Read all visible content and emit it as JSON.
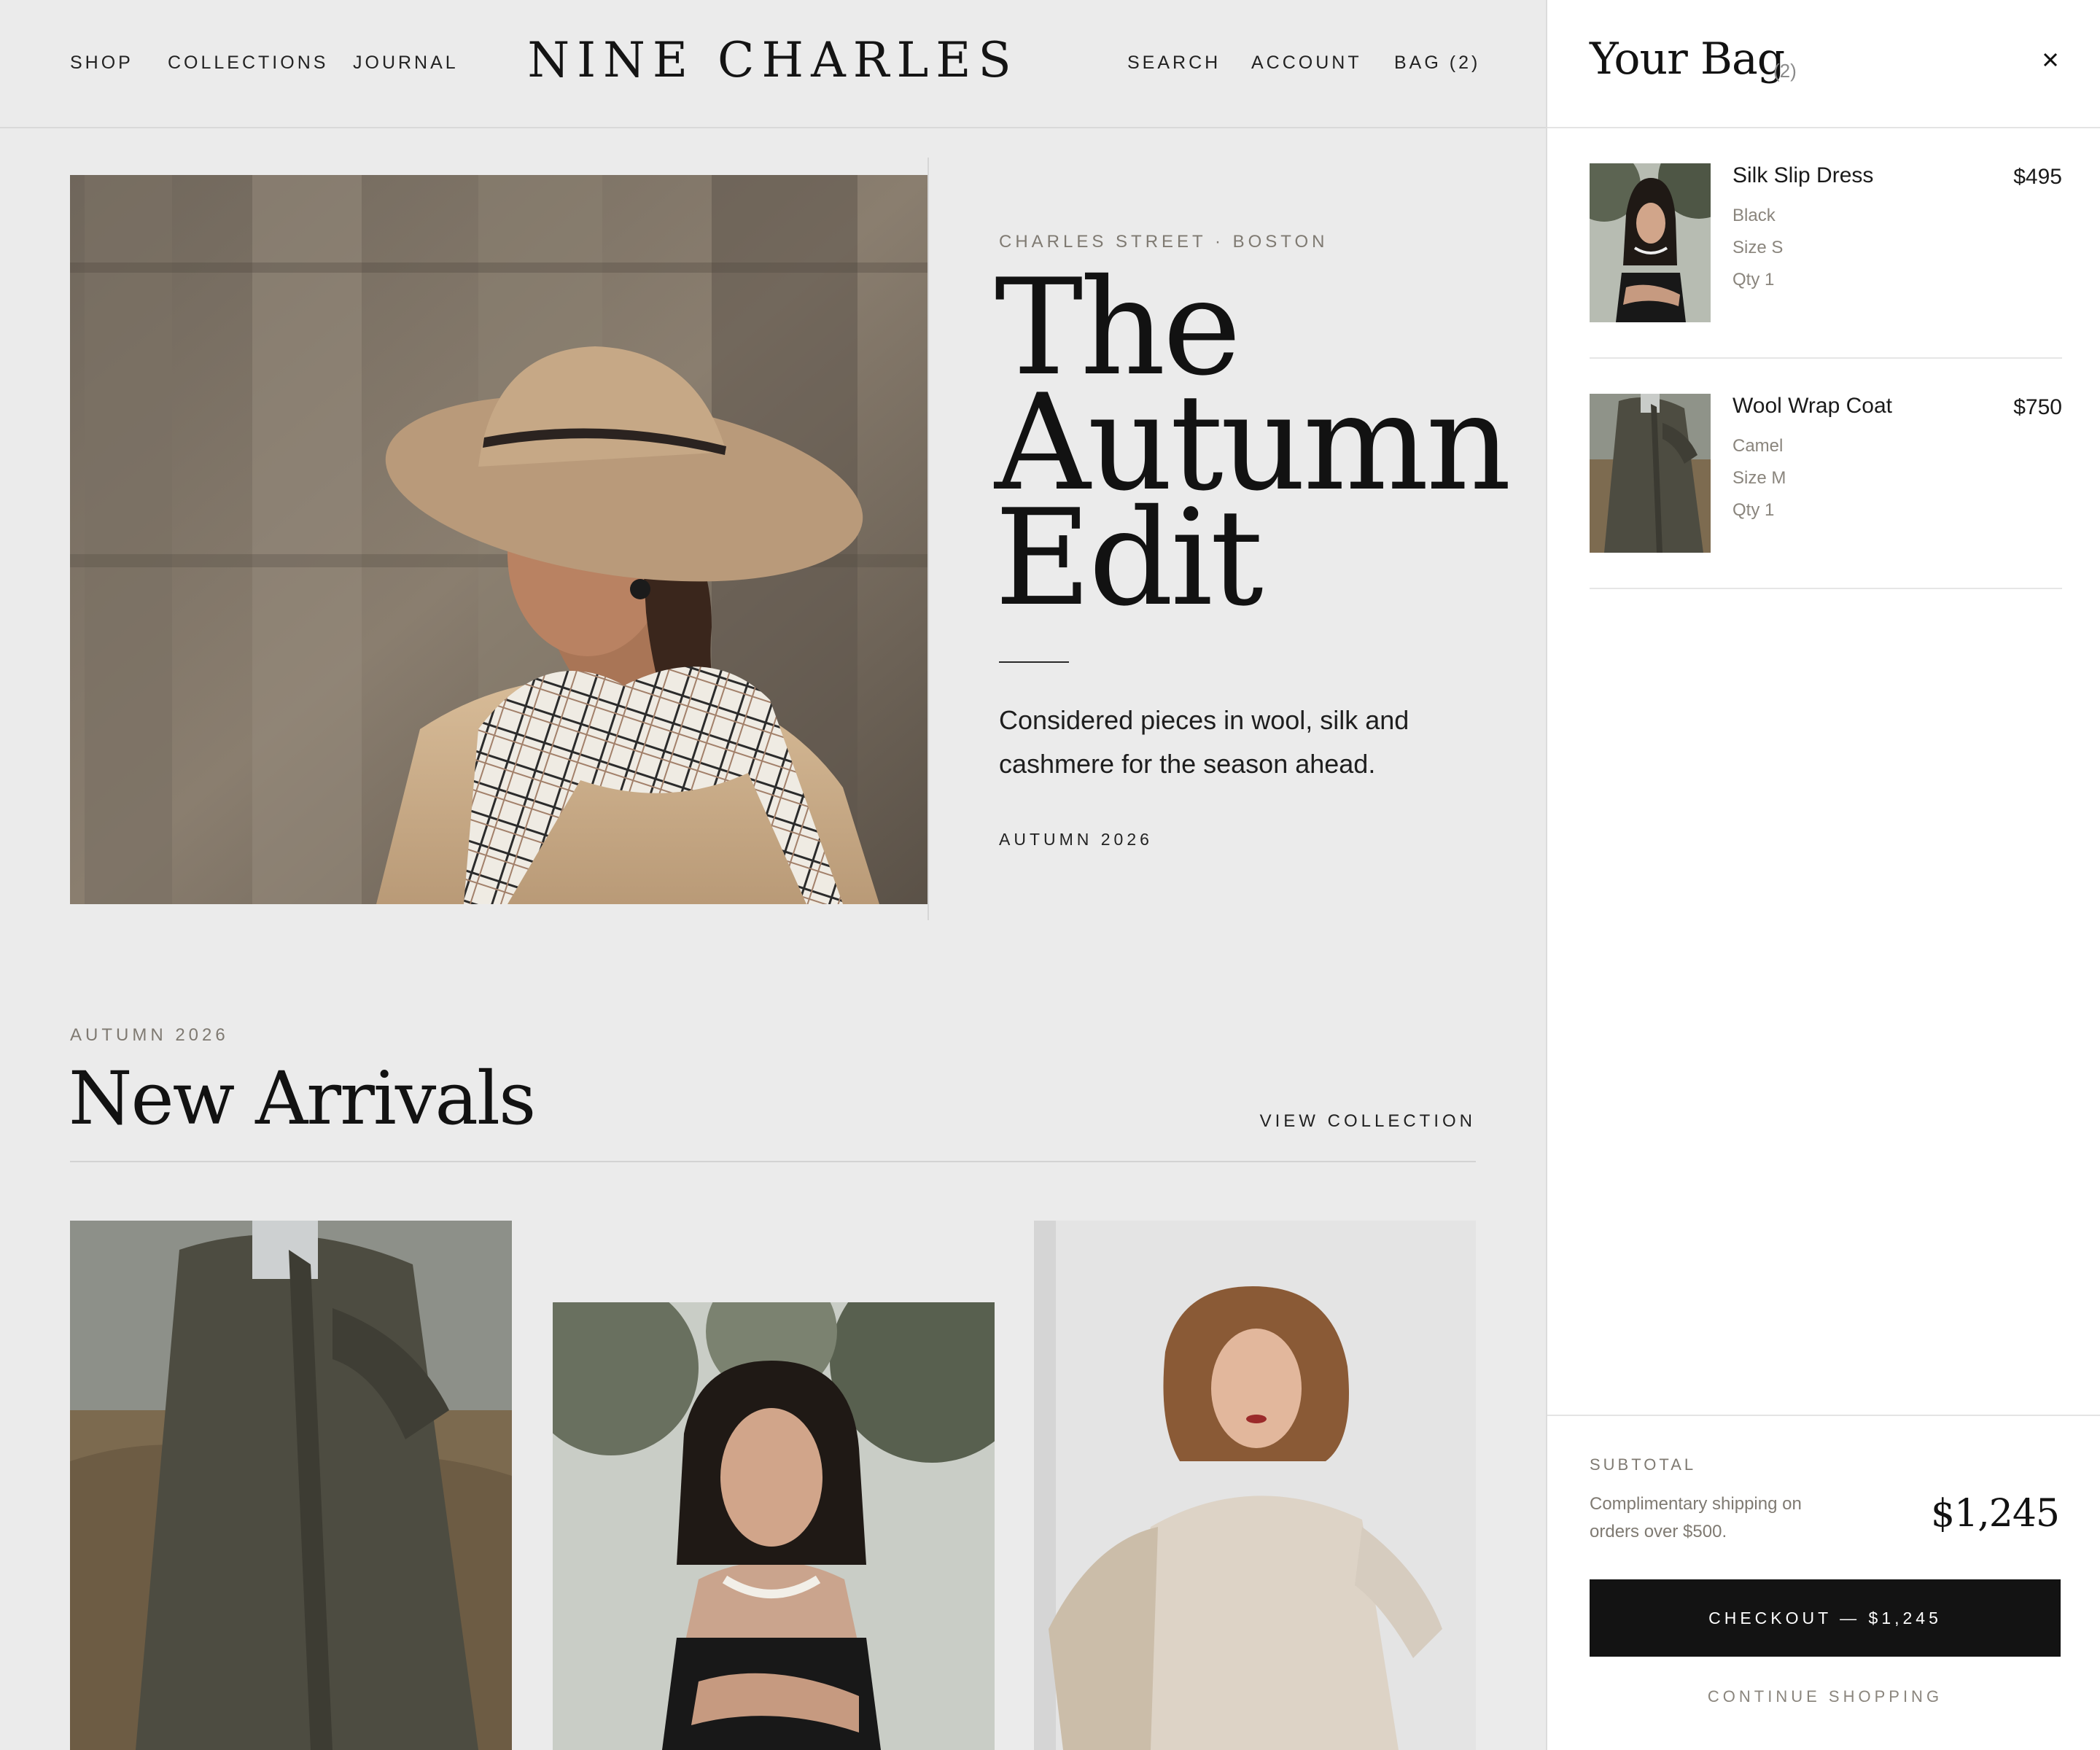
{
  "header": {
    "nav_left": [
      "SHOP",
      "COLLECTIONS",
      "JOURNAL"
    ],
    "logo": "NINE CHARLES",
    "nav_right": [
      "SEARCH",
      "ACCOUNT",
      "BAG (2)"
    ]
  },
  "hero": {
    "eyebrow": "CHARLES STREET · BOSTON",
    "title_lines": [
      "The",
      "Autumn",
      "Edit"
    ],
    "description": "Considered pieces in wool, silk and cashmere for the season ahead.",
    "tag": "AUTUMN 2026"
  },
  "arrivals": {
    "eyebrow": "AUTUMN 2026",
    "title": "New Arrivals",
    "view_link": "VIEW COLLECTION"
  },
  "bag": {
    "title": "Your Bag",
    "count": "(2)",
    "items": [
      {
        "name": "Silk Slip Dress",
        "price": "$495",
        "color": "Black",
        "size": "Size S",
        "qty": "Qty 1"
      },
      {
        "name": "Wool Wrap Coat",
        "price": "$750",
        "color": "Camel",
        "size": "Size M",
        "qty": "Qty 1"
      }
    ],
    "subtotal_label": "SUBTOTAL",
    "shipping_note": "Complimentary shipping on orders over $500.",
    "subtotal_value": "$1,245",
    "checkout_label": "CHECKOUT — $1,245",
    "continue_label": "CONTINUE SHOPPING"
  },
  "colors": {
    "page_bg": "#ebebeb",
    "drawer_bg": "#ffffff",
    "button_bg": "#131313",
    "muted_text": "#7f7a72"
  }
}
